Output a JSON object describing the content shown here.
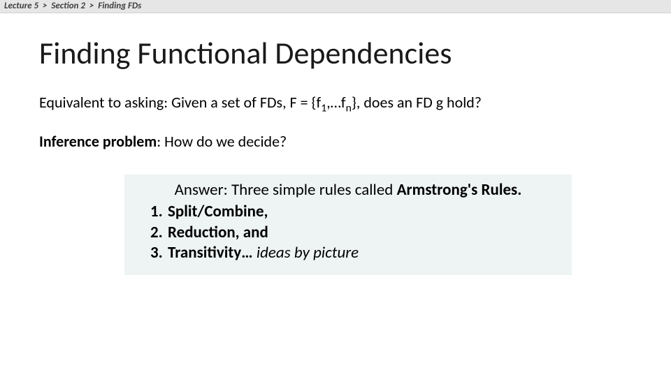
{
  "breadcrumb": {
    "lecture": "Lecture 5",
    "sep1": ">",
    "section": "Section 2",
    "sep2": ">",
    "topic": "Finding FDs"
  },
  "title": "Finding Functional Dependencies",
  "equiv": {
    "prefix": "Equivalent to asking: Given a set of FDs, F = {f",
    "sub1": "1",
    "mid": ",…f",
    "sub2": "n",
    "suffix": "}, does an FD g hold?"
  },
  "inference": {
    "label": "Inference problem",
    "rest": ": How do we decide?"
  },
  "answer": {
    "lead_plain": "Answer: Three simple rules called ",
    "lead_bold": "Armstrong's Rules.",
    "rules": {
      "r1": "Split/Combine,",
      "r2": "Reduction, and",
      "r3_bold": "Transitivity… ",
      "r3_italic": "ideas by picture"
    }
  }
}
